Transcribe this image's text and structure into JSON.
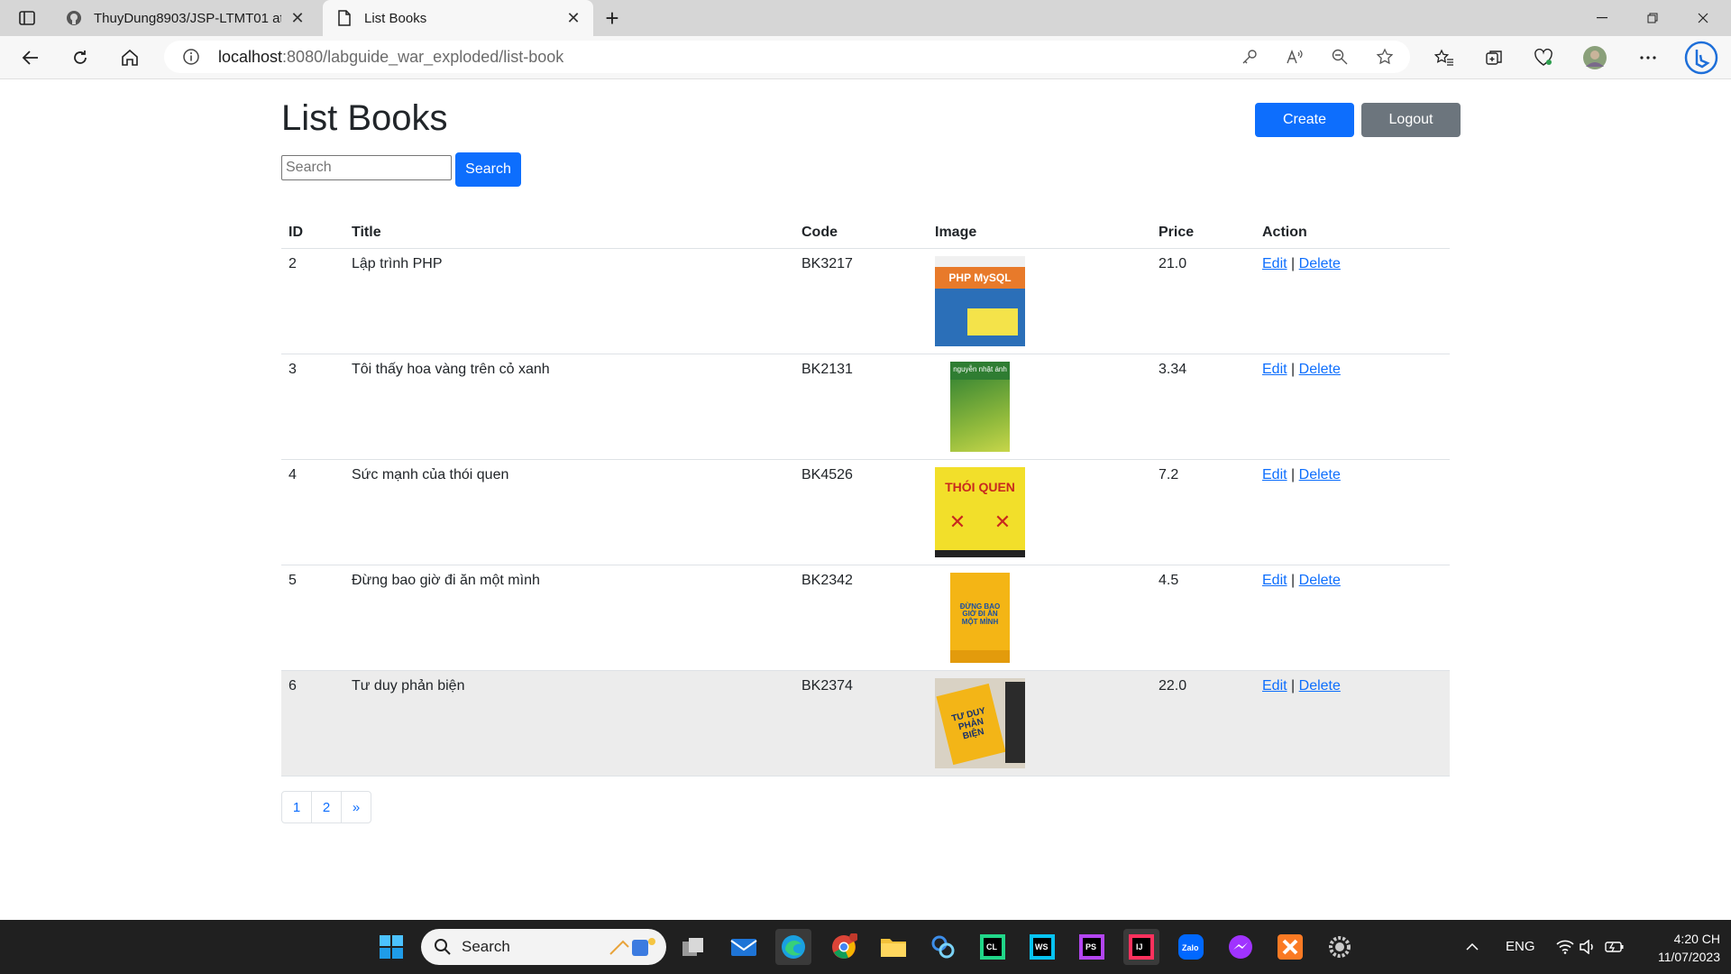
{
  "browser": {
    "tabs": [
      {
        "label": "ThuyDung8903/JSP-LTMT01 at b",
        "active": false,
        "icon": "github-icon"
      },
      {
        "label": "List Books",
        "active": true,
        "icon": "page-icon"
      }
    ],
    "address": {
      "host": "localhost",
      "path": ":8080/labguide_war_exploded/list-book"
    }
  },
  "page": {
    "title": "List Books",
    "create_label": "Create",
    "logout_label": "Logout",
    "search_placeholder": "Search",
    "search_button": "Search"
  },
  "table": {
    "headers": {
      "id": "ID",
      "title": "Title",
      "code": "Code",
      "image": "Image",
      "price": "Price",
      "action": "Action"
    },
    "edit_label": "Edit",
    "delete_label": "Delete",
    "separator": "|",
    "rows": [
      {
        "id": "2",
        "title": "Lập trình PHP",
        "code": "BK3217",
        "price": "21.0",
        "cover_text": "PHP MySQL"
      },
      {
        "id": "3",
        "title": "Tôi thấy hoa vàng trên cỏ xanh",
        "code": "BK2131",
        "price": "3.34",
        "cover_text": "nguyễn nhật ánh"
      },
      {
        "id": "4",
        "title": "Sức mạnh của thói quen",
        "code": "BK4526",
        "price": "7.2",
        "cover_text": "THÓI QUEN"
      },
      {
        "id": "5",
        "title": "Đừng bao giờ đi ăn một mình",
        "code": "BK2342",
        "price": "4.5",
        "cover_text": "ĐỪNG BAO GIỜ ĐI ĂN MỘT MÌNH"
      },
      {
        "id": "6",
        "title": "Tư duy phản biện",
        "code": "BK2374",
        "price": "22.0",
        "cover_text": "TƯ DUY PHẢN BIỆN"
      }
    ]
  },
  "pagination": [
    "1",
    "2",
    "»"
  ],
  "taskbar": {
    "search_label": "Search",
    "language": "ENG",
    "time": "4:20 CH",
    "date": "11/07/2023"
  }
}
